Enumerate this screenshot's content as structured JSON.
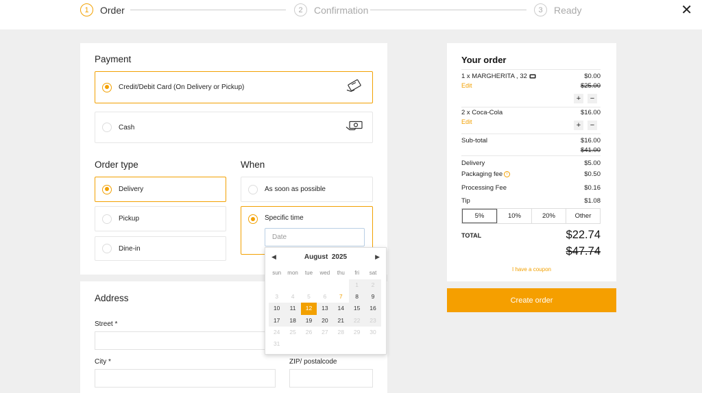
{
  "stepper": {
    "steps": [
      {
        "num": "1",
        "label": "Order"
      },
      {
        "num": "2",
        "label": "Confirmation"
      },
      {
        "num": "3",
        "label": "Ready"
      }
    ],
    "close": "✕"
  },
  "payment": {
    "title": "Payment",
    "options": [
      "Credit/Debit Card (On Delivery or Pickup)",
      "Cash"
    ]
  },
  "order_type": {
    "title": "Order type",
    "options": [
      "Delivery",
      "Pickup",
      "Dine-in"
    ]
  },
  "when": {
    "title": "When",
    "options": [
      "As soon as possible",
      "Specific time"
    ],
    "date_placeholder": "Date"
  },
  "calendar": {
    "month": "August",
    "year": "2025",
    "prev": "◀",
    "next": "▶",
    "weekdays": [
      "sun",
      "mon",
      "tue",
      "wed",
      "thu",
      "fri",
      "sat"
    ],
    "days": [
      "",
      "",
      "",
      "",
      "",
      "1",
      "2",
      "3",
      "4",
      "5",
      "6",
      "7",
      "8",
      "9",
      "10",
      "11",
      "12",
      "13",
      "14",
      "15",
      "16",
      "17",
      "18",
      "19",
      "20",
      "21",
      "22",
      "23",
      "24",
      "25",
      "26",
      "27",
      "28",
      "29",
      "30",
      "31"
    ],
    "selected": "12",
    "highlight": "7"
  },
  "address": {
    "title": "Address",
    "street_label": "Street *",
    "city_label": "City *",
    "zip_label": "ZIP/ postalcode"
  },
  "order": {
    "title": "Your order",
    "items": [
      {
        "name": "1 x MARGHERITA , 32",
        "price": "$0.00",
        "old_price": "$25.00",
        "edit": "Edit"
      },
      {
        "name": "2 x Coca-Cola",
        "price": "$16.00",
        "edit": "Edit"
      }
    ],
    "plus": "+",
    "minus": "−",
    "subtotal_label": "Sub-total",
    "subtotal": "$16.00",
    "subtotal_old": "$41.00",
    "delivery_label": "Delivery",
    "delivery": "$5.00",
    "packaging_label": "Packaging fee",
    "packaging": "$0.50",
    "processing_label": "Processing Fee",
    "processing": "$0.16",
    "tip_label": "Tip",
    "tip": "$1.08",
    "tip_options": [
      "5%",
      "10%",
      "20%",
      "Other"
    ],
    "total_label": "TOTAL",
    "total": "$22.74",
    "total_old": "$47.74",
    "coupon": "I have a coupon",
    "create_button": "Create order"
  },
  "colors": {
    "accent": "#f2a000",
    "button": "#f59f00"
  }
}
